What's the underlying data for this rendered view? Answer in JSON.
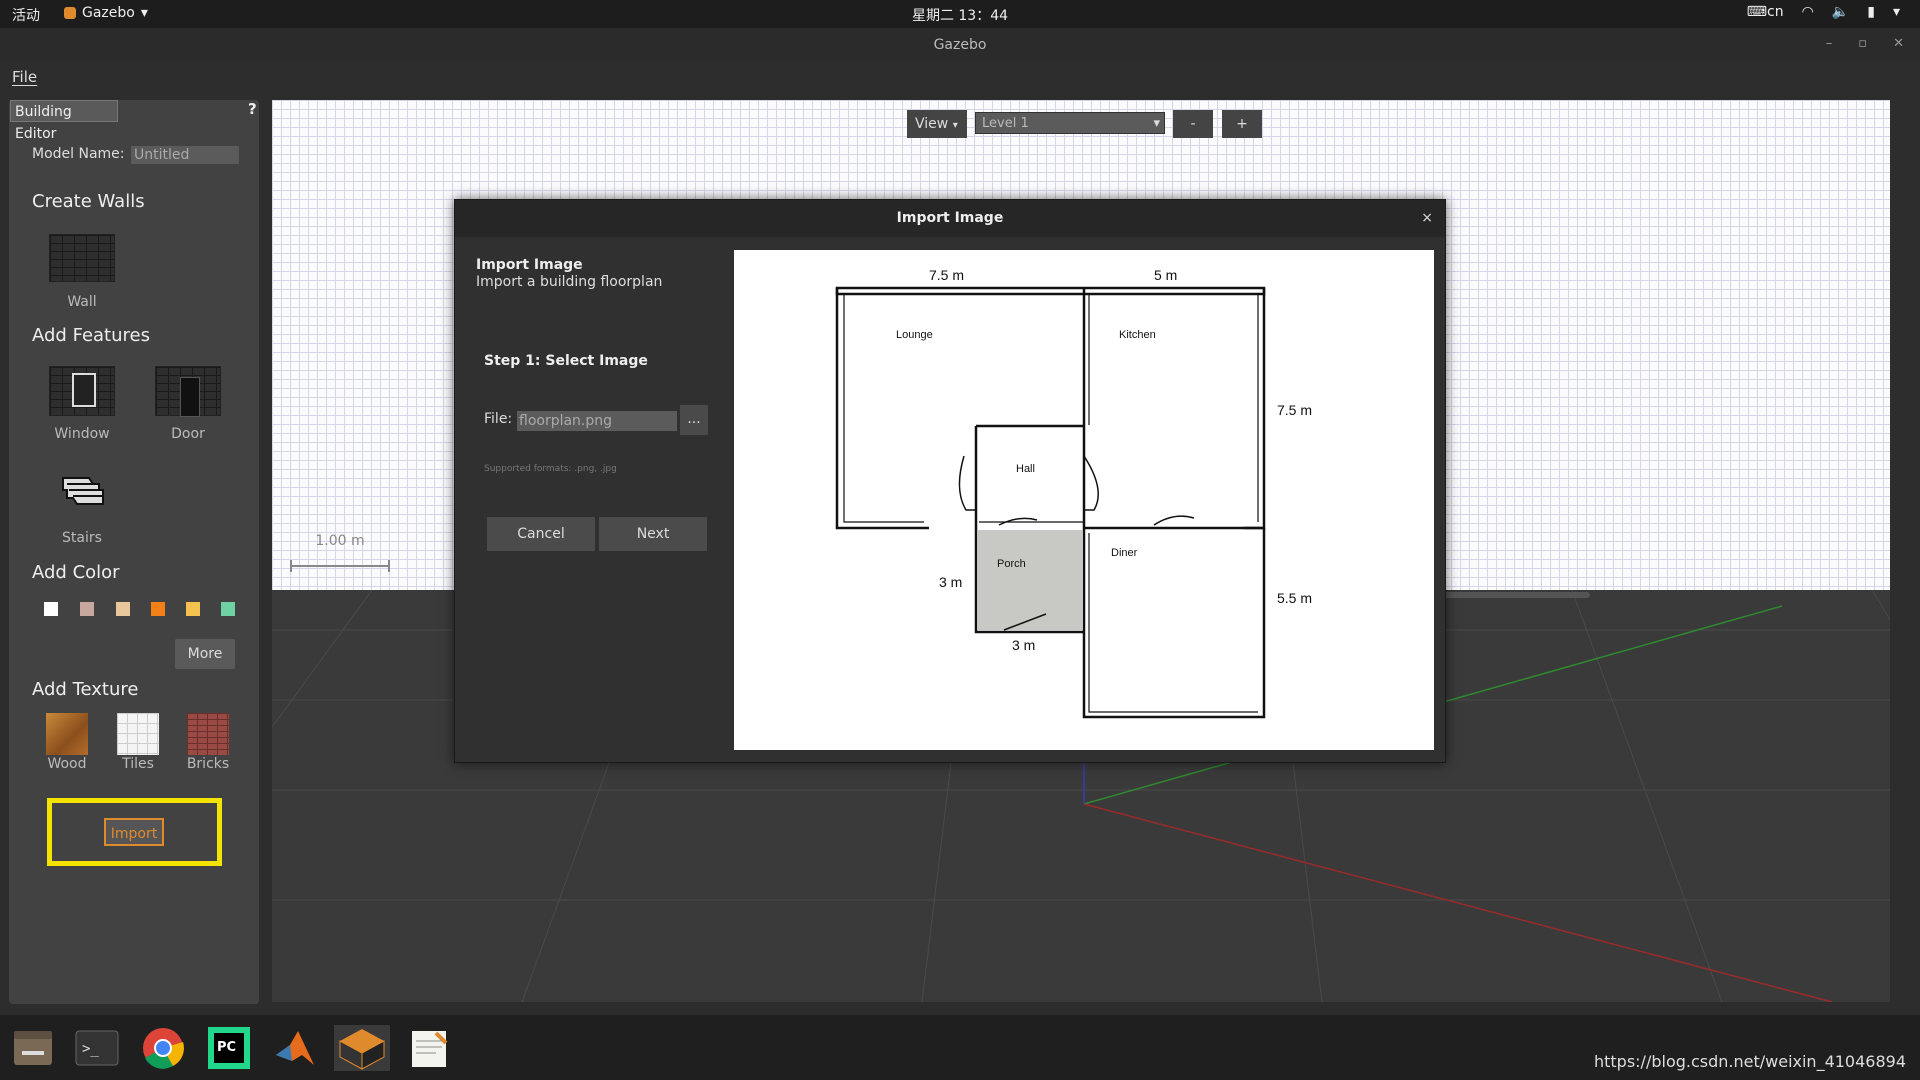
{
  "top_panel": {
    "activities": "活动",
    "app_name": "Gazebo",
    "clock": "星期二 13：44",
    "input_method": "cn"
  },
  "window": {
    "title": "Gazebo"
  },
  "menubar": {
    "file": "File"
  },
  "left_panel": {
    "tab": "Building Editor",
    "help": "?",
    "model_name_label": "Model Name:",
    "model_name_value": "Untitled",
    "create_walls": "Create Walls",
    "wall": "Wall",
    "add_features": "Add Features",
    "window": "Window",
    "door": "Door",
    "stairs": "Stairs",
    "add_color": "Add Color",
    "colors": [
      "#ffffff",
      "#c8a89e",
      "#e8c89a",
      "#f57f17",
      "#f3c24e",
      "#6fd2a4"
    ],
    "more": "More",
    "add_texture": "Add Texture",
    "textures": [
      "Wood",
      "Tiles",
      "Bricks"
    ],
    "import": "Import"
  },
  "toolbar": {
    "view": "View",
    "level": "Level 1",
    "minus": "-",
    "plus": "+"
  },
  "scale": "1.00 m",
  "dialog": {
    "title": "Import Image",
    "close": "×",
    "heading": "Import Image",
    "subheading": "Import a building floorplan",
    "step": "Step 1: Select Image",
    "file_label": "File:",
    "file_value": "floorplan.png",
    "browse": "...",
    "formats": "Supported formats: .png, .jpg",
    "cancel": "Cancel",
    "next": "Next"
  },
  "floorplan": {
    "dim_top_left": "7.5 m",
    "dim_top_right": "5 m",
    "dim_right_top": "7.5 m",
    "dim_right_bottom": "5.5 m",
    "dim_left_porch": "3 m",
    "dim_bottom_porch": "3 m",
    "rooms": [
      "Lounge",
      "Kitchen",
      "Hall",
      "Porch",
      "Diner"
    ]
  },
  "watermark": "https://blog.csdn.net/weixin_41046894"
}
